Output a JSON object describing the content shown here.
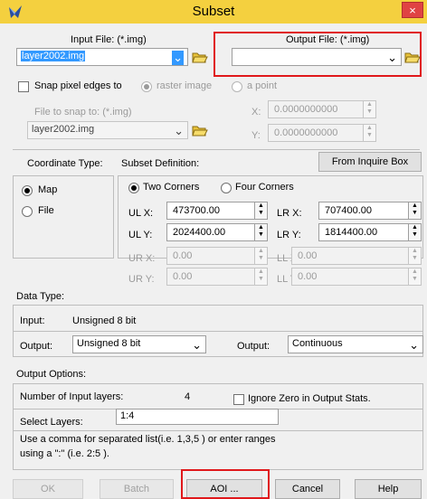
{
  "dialog": {
    "title": "Subset",
    "close_glyph": "×"
  },
  "files": {
    "input_label": "Input File: (*.img)",
    "input_value": "layer2002.img",
    "output_label": "Output File: (*.img)",
    "output_value": ""
  },
  "snap": {
    "checkbox_label": "Snap pixel edges to",
    "raster_label": "raster image",
    "point_label": "a point",
    "file_label": "File to snap to: (*.img)",
    "file_value": "layer2002.img",
    "x_label": "X:",
    "x_value": "0.0000000000",
    "y_label": "Y:",
    "y_value": "0.0000000000"
  },
  "coordinate": {
    "type_label": "Coordinate Type:",
    "map_label": "Map",
    "file_label": "File"
  },
  "subset": {
    "definition_label": "Subset Definition:",
    "inquire_button": "From Inquire Box",
    "two_corners_label": "Two Corners",
    "four_corners_label": "Four Corners",
    "ulx_label": "UL X:",
    "ulx_value": "473700.00",
    "uly_label": "UL Y:",
    "uly_value": "2024400.00",
    "urx_label": "UR X:",
    "urx_value": "0.00",
    "ury_label": "UR Y:",
    "ury_value": "0.00",
    "lrx_label": "LR X:",
    "lrx_value": "707400.00",
    "lry_label": "LR Y:",
    "lry_value": "1814400.00",
    "llx_label": "LL X:",
    "llx_value": "0.00",
    "lly_label": "LL Y:",
    "lly_value": "0.00"
  },
  "data_type": {
    "section_label": "Data Type:",
    "input_label": "Input:",
    "input_value": "Unsigned 8 bit",
    "output_label": "Output:",
    "output_value": "Unsigned 8 bit",
    "output2_label": "Output:",
    "output2_value": "Continuous"
  },
  "output_options": {
    "section_label": "Output Options:",
    "num_layers_label": "Number of Input layers:",
    "num_layers_value": "4",
    "ignore_zero_label": "Ignore Zero in Output Stats.",
    "select_layers_label": "Select Layers:",
    "select_layers_value": "1:4",
    "help_line1": "Use a comma for separated list(i.e. 1,3,5 ) or enter ranges",
    "help_line2": "using a \":\" (i.e. 2:5 )."
  },
  "buttons": {
    "ok": "OK",
    "batch": "Batch",
    "aoi": "AOI ...",
    "cancel": "Cancel",
    "help": "Help"
  },
  "colors": {
    "titlebar": "#f4d03f",
    "highlight": "#e0181b",
    "selection": "#3399ff"
  }
}
